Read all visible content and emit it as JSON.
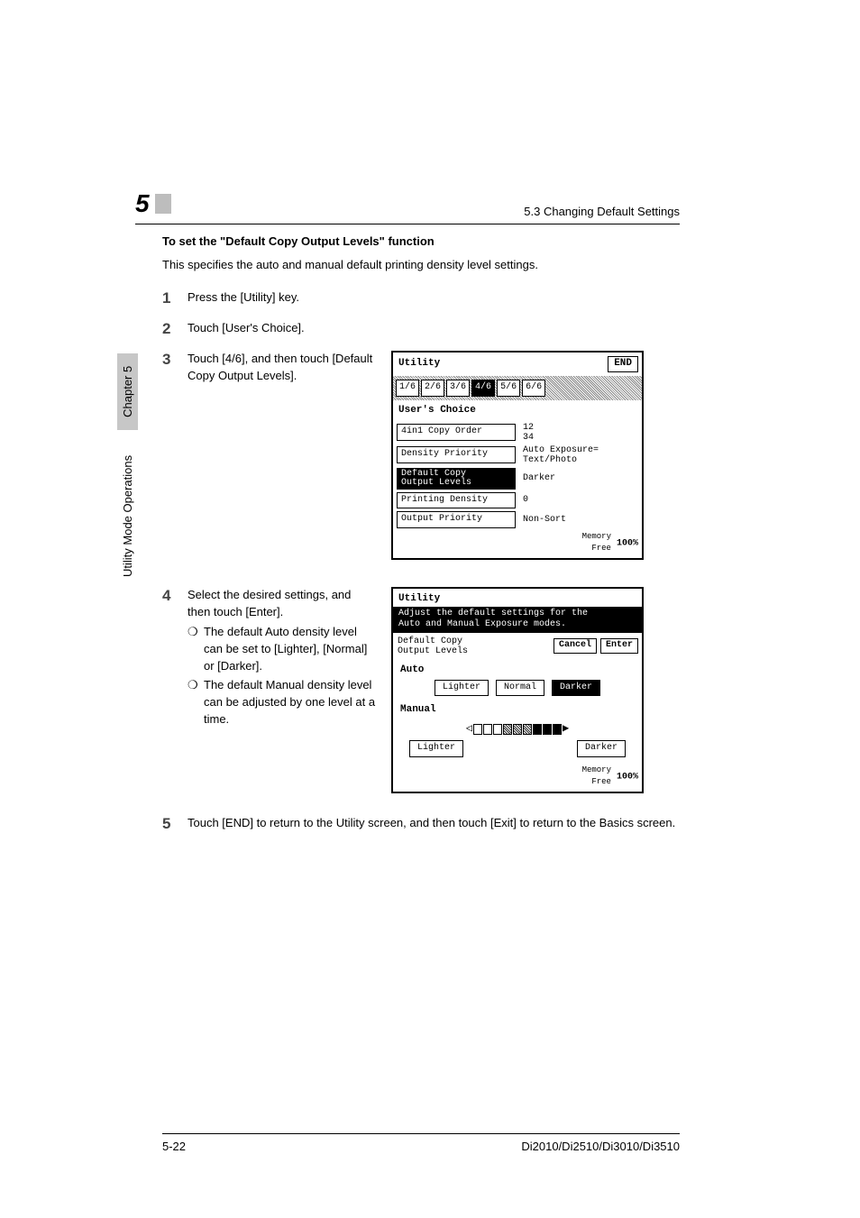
{
  "header": {
    "chapter_number": "5",
    "running_title": "5.3 Changing Default Settings"
  },
  "sidebar": {
    "chapter_tab": "Chapter 5",
    "label": "Utility Mode Operations"
  },
  "section": {
    "heading": "To set the \"Default Copy Output Levels\" function",
    "intro": "This specifies the auto and manual default printing density level settings."
  },
  "steps": {
    "s1": {
      "num": "1",
      "text": "Press the [Utility] key."
    },
    "s2": {
      "num": "2",
      "text": "Touch [User's Choice]."
    },
    "s3": {
      "num": "3",
      "text": "Touch [4/6], and then touch [Default Copy Output Levels]."
    },
    "s4": {
      "num": "4",
      "text": "Select the desired settings, and then touch [Enter].",
      "bullets": {
        "b1": "The default Auto density level can be set to [Lighter], [Normal] or [Darker].",
        "b2": "The default Manual density level can be adjusted by one level at a time."
      }
    },
    "s5": {
      "num": "5",
      "text": "Touch [END] to return to the Utility screen, and then touch [Exit] to return to the Basics screen."
    }
  },
  "figure1": {
    "title": "Utility",
    "end": "END",
    "tabs": {
      "t1": "1/6",
      "t2": "2/6",
      "t3": "3/6",
      "t4": "4/6",
      "t5": "5/6",
      "t6": "6/6"
    },
    "section_label": "User's Choice",
    "rows": {
      "r1": {
        "label": "4in1 Copy Order",
        "value_top": "12",
        "value_bot": "34"
      },
      "r2": {
        "label": "Density Priority",
        "value_top": "Auto Exposure=",
        "value_bot": "Text/Photo"
      },
      "r3": {
        "label": "Default Copy\nOutput Levels",
        "value": "Darker"
      },
      "r4": {
        "label": "Printing Density",
        "value": "0"
      },
      "r5": {
        "label": "Output Priority",
        "value": "Non-Sort"
      }
    },
    "memory": {
      "small": "Memory\nFree",
      "pct": "100%"
    }
  },
  "figure2": {
    "title": "Utility",
    "message_l1": "Adjust the default settings for the",
    "message_l2": "Auto and Manual Exposure modes.",
    "top_label": "Default Copy\nOutput Levels",
    "cancel": "Cancel",
    "enter": "Enter",
    "auto": {
      "label": "Auto",
      "lighter": "Lighter",
      "normal": "Normal",
      "darker": "Darker"
    },
    "manual": {
      "label": "Manual",
      "lighter": "Lighter",
      "darker": "Darker"
    },
    "memory": {
      "small": "Memory\nFree",
      "pct": "100%"
    }
  },
  "footer": {
    "page": "5-22",
    "models": "Di2010/Di2510/Di3010/Di3510"
  }
}
